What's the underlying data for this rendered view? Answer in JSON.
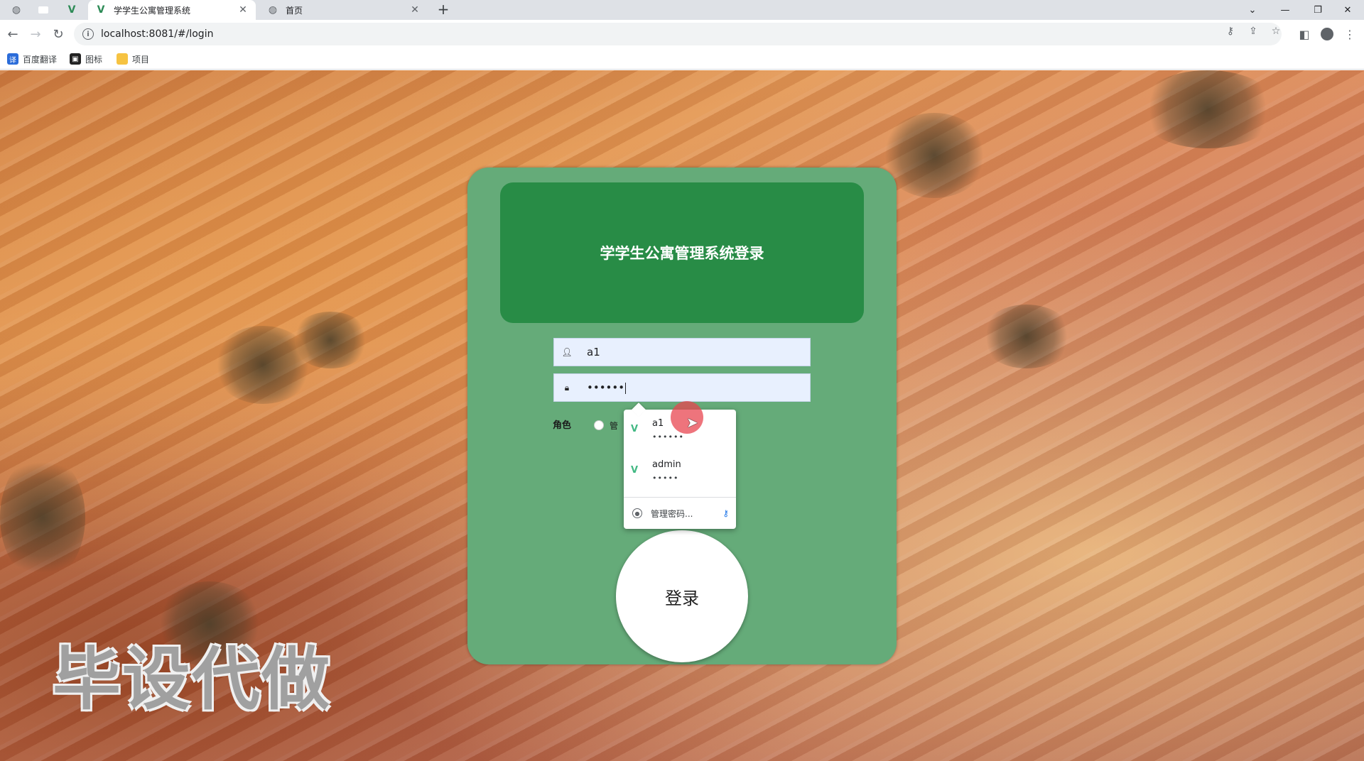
{
  "browser": {
    "tabs": [
      {
        "title": "学学生公寓管理系统",
        "active": true,
        "icon": "vue-icon"
      },
      {
        "title": "首页",
        "active": false,
        "icon": "globe-icon"
      }
    ],
    "url": "localhost:8081/#/login",
    "bookmarks": [
      {
        "label": "百度翻译",
        "icon": "translate-icon"
      },
      {
        "label": "图标",
        "icon": "image-icon"
      },
      {
        "label": "项目",
        "icon": "folder-icon"
      }
    ]
  },
  "login": {
    "title": "学学生公寓管理系统登录",
    "username_value": "a1",
    "password_value": "••••••",
    "role_label": "角色",
    "role_option": "管",
    "submit_label": "登录"
  },
  "autofill": {
    "entries": [
      {
        "username": "a1",
        "password": "••••••"
      },
      {
        "username": "admin",
        "password": "•••••"
      }
    ],
    "manage_label": "管理密码..."
  },
  "watermark": "毕设代做",
  "colors": {
    "card": "#65ab79",
    "header": "#288c46",
    "field": "#e8f0fe"
  }
}
